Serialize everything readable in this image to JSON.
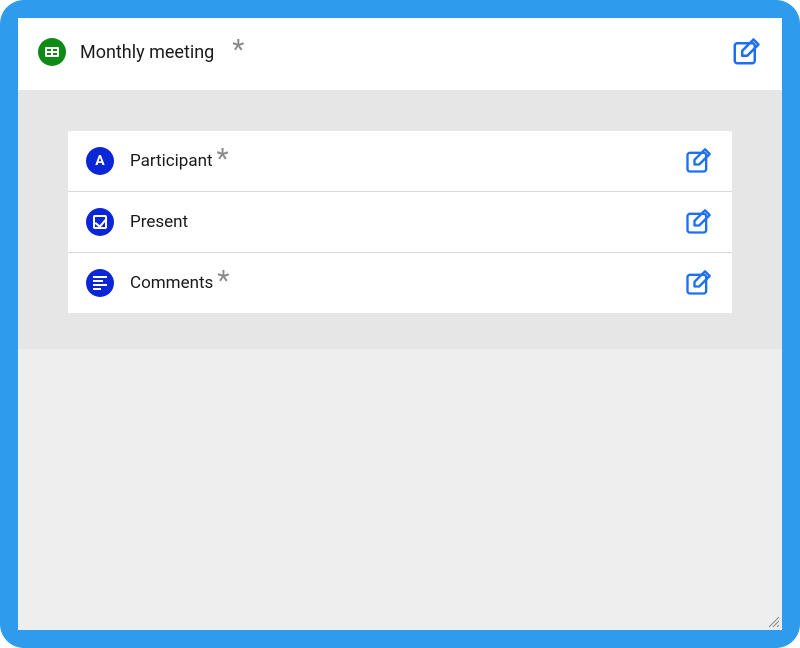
{
  "header": {
    "title": "Monthly meeting",
    "required": true,
    "icon": "grid-table"
  },
  "fields": [
    {
      "id": "participant",
      "label": "Participant",
      "required": true,
      "icon": "letter-a"
    },
    {
      "id": "present",
      "label": "Present",
      "required": false,
      "icon": "checkbox"
    },
    {
      "id": "comments",
      "label": "Comments",
      "required": true,
      "icon": "text-lines"
    }
  ],
  "colors": {
    "frame": "#2f9bed",
    "header_icon_bg": "#0e8a16",
    "field_icon_bg": "#0b26d6",
    "edit_icon": "#1d6ff2"
  }
}
